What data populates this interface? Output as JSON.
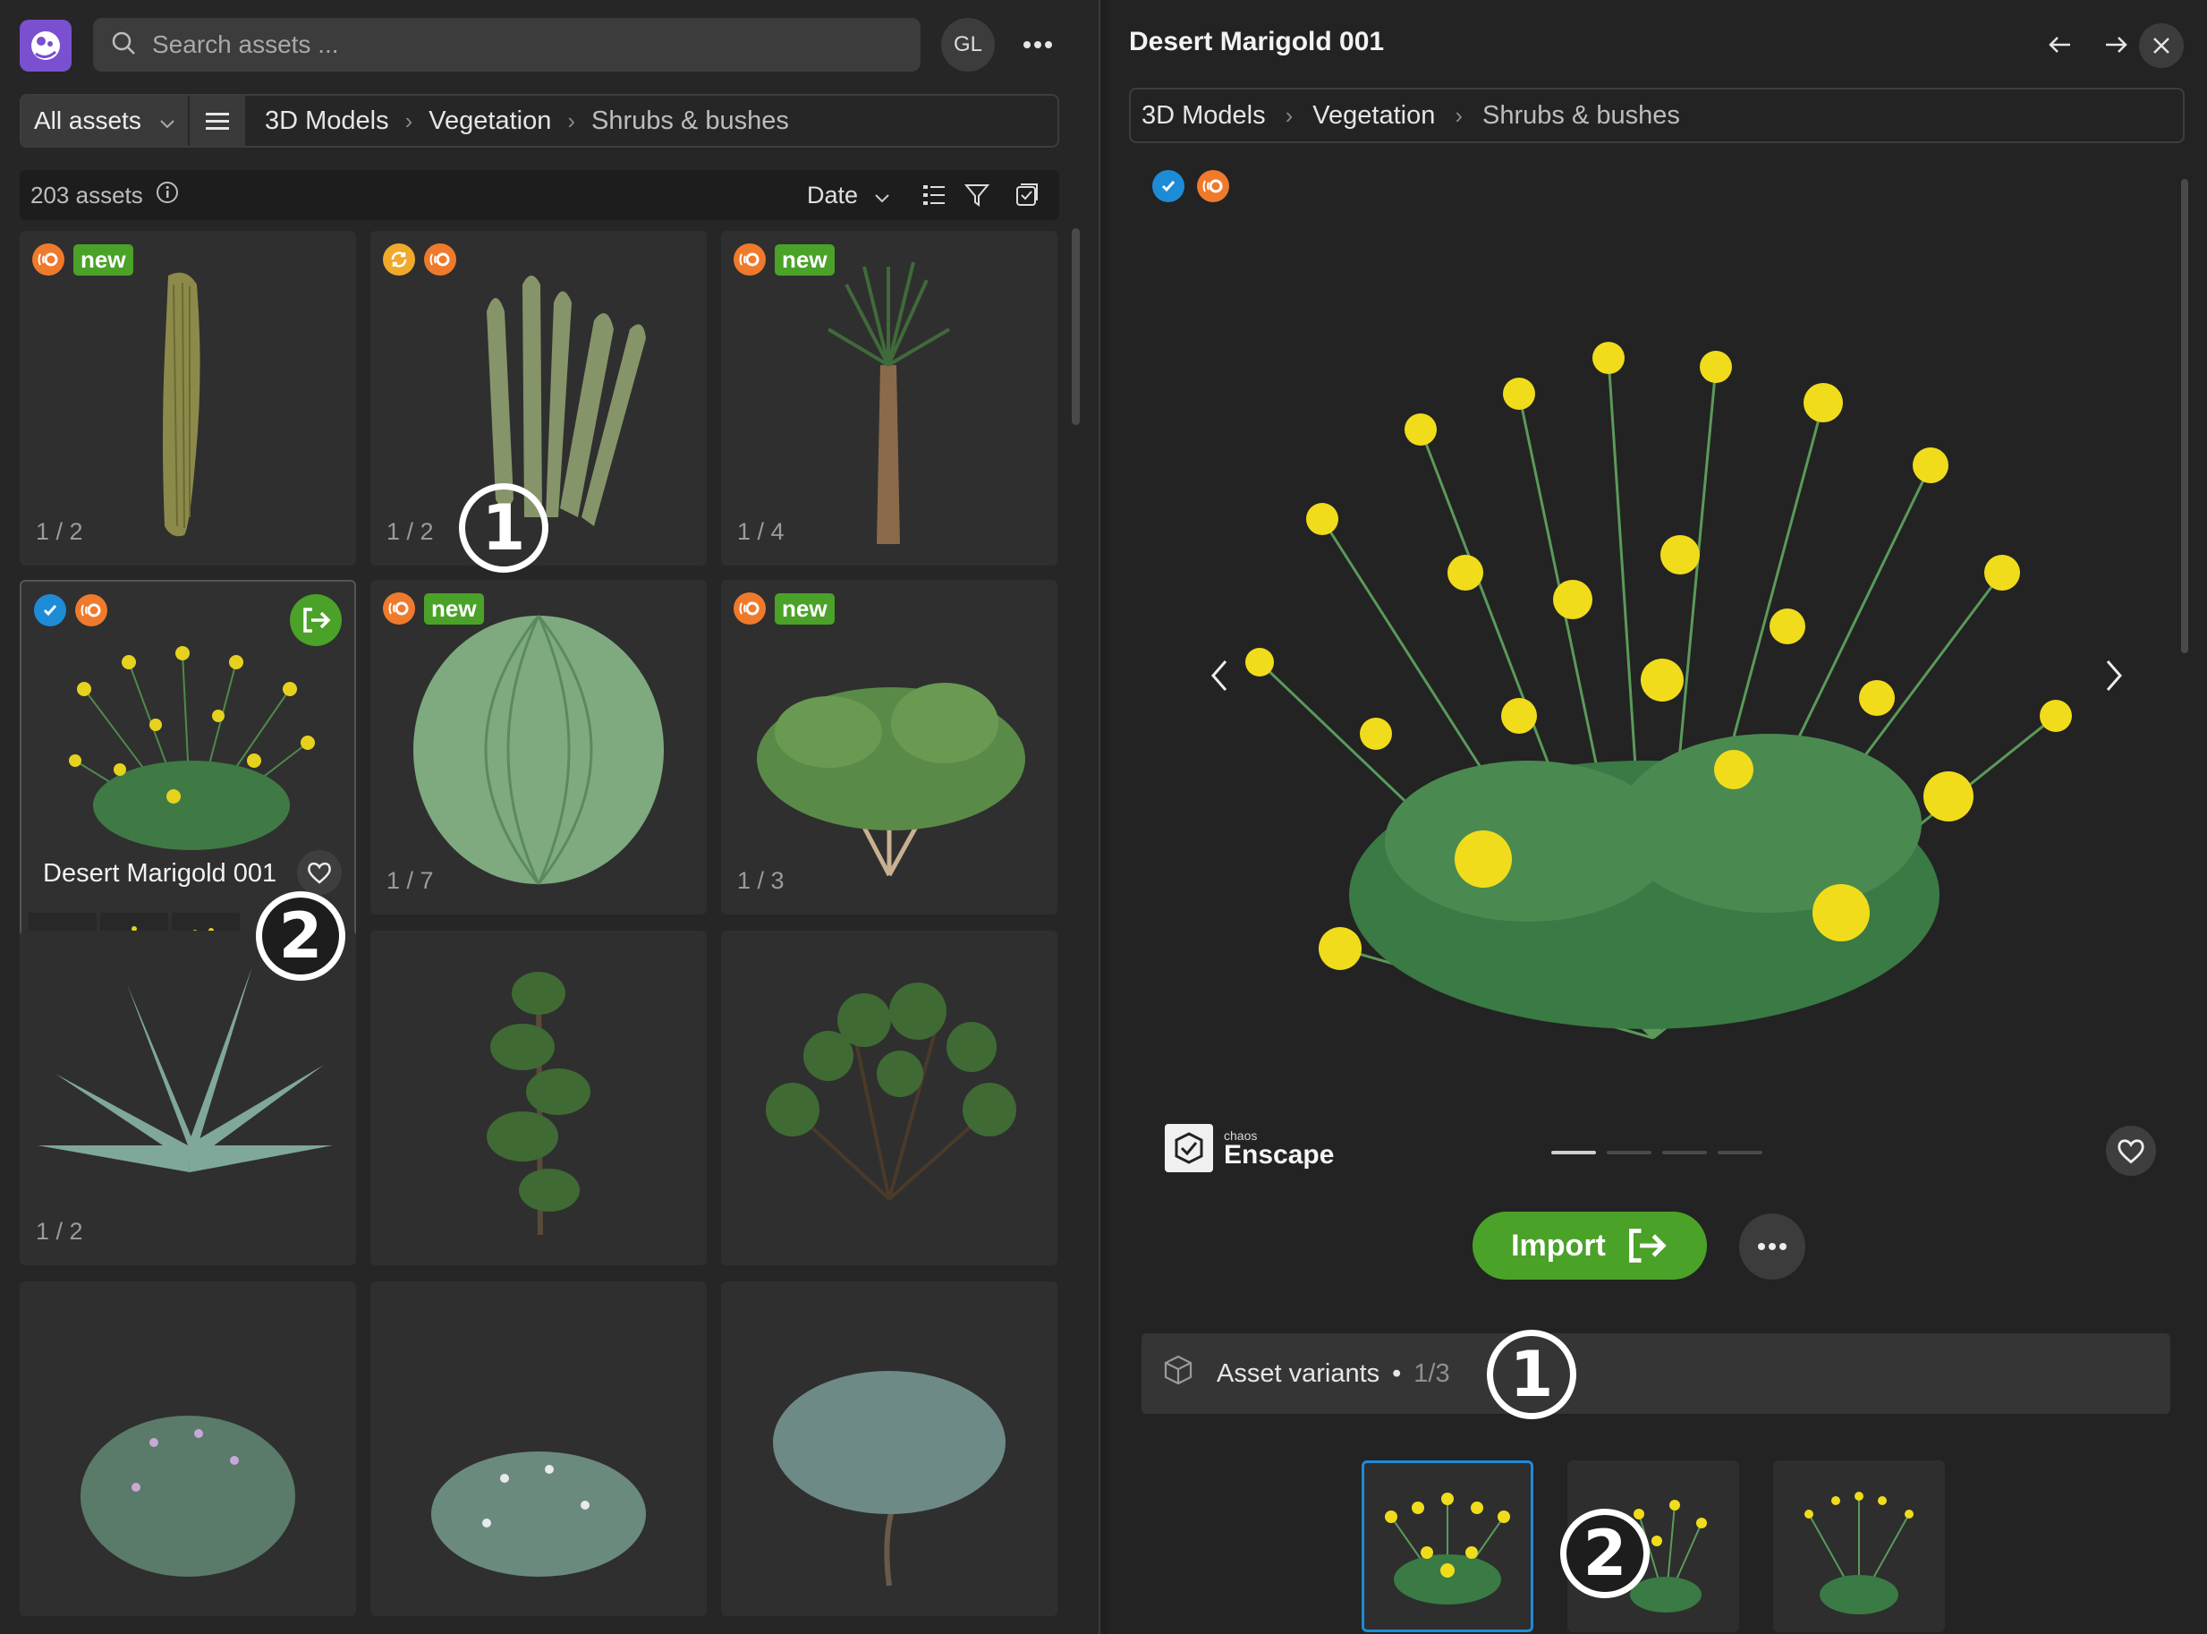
{
  "search": {
    "placeholder": "Search assets ..."
  },
  "user": {
    "initials": "GL"
  },
  "filter": {
    "scope": "All assets"
  },
  "breadcrumb": {
    "c1": "3D Models",
    "c2": "Vegetation",
    "c3": "Shrubs & bushes"
  },
  "count": {
    "text": "203 assets"
  },
  "sort": {
    "label": "Date"
  },
  "cards": {
    "c0": {
      "tag": "new",
      "counter": "1 / 2"
    },
    "c1": {
      "counter": "1 / 2"
    },
    "c2": {
      "tag": "new",
      "counter": "1 / 4"
    },
    "c3": {
      "title": "Desert Marigold 001"
    },
    "c4": {
      "tag": "new",
      "counter": "1 / 7"
    },
    "c5": {
      "tag": "new",
      "counter": "1 / 3"
    },
    "c6": {
      "counter": "1 / 2"
    }
  },
  "annotations": {
    "one": "1",
    "two": "2"
  },
  "detail": {
    "title": "Desert Marigold 001",
    "brand_sub": "chaos",
    "brand_main": "Enscape",
    "import_label": "Import",
    "variants_label": "Asset variants",
    "variants_count": "1/3"
  },
  "colors": {
    "accent_green": "#4aa228",
    "accent_blue": "#1e8bd7",
    "accent_orange": "#f07a2b",
    "brand_purple": "#7a4fd0"
  },
  "icons": {
    "search": "search-icon",
    "more": "more-horizontal-icon",
    "chevron": "chevron-down-icon",
    "list": "list-icon",
    "info": "info-icon",
    "filter": "filter-icon",
    "checklist": "checklist-icon",
    "heart": "heart-icon",
    "import": "import-icon",
    "close": "close-icon",
    "arrow_left": "arrow-left-icon",
    "arrow_right": "arrow-right-icon",
    "cube": "cube-icon",
    "check": "check-circle-icon",
    "enscape": "enscape-logo-icon"
  }
}
